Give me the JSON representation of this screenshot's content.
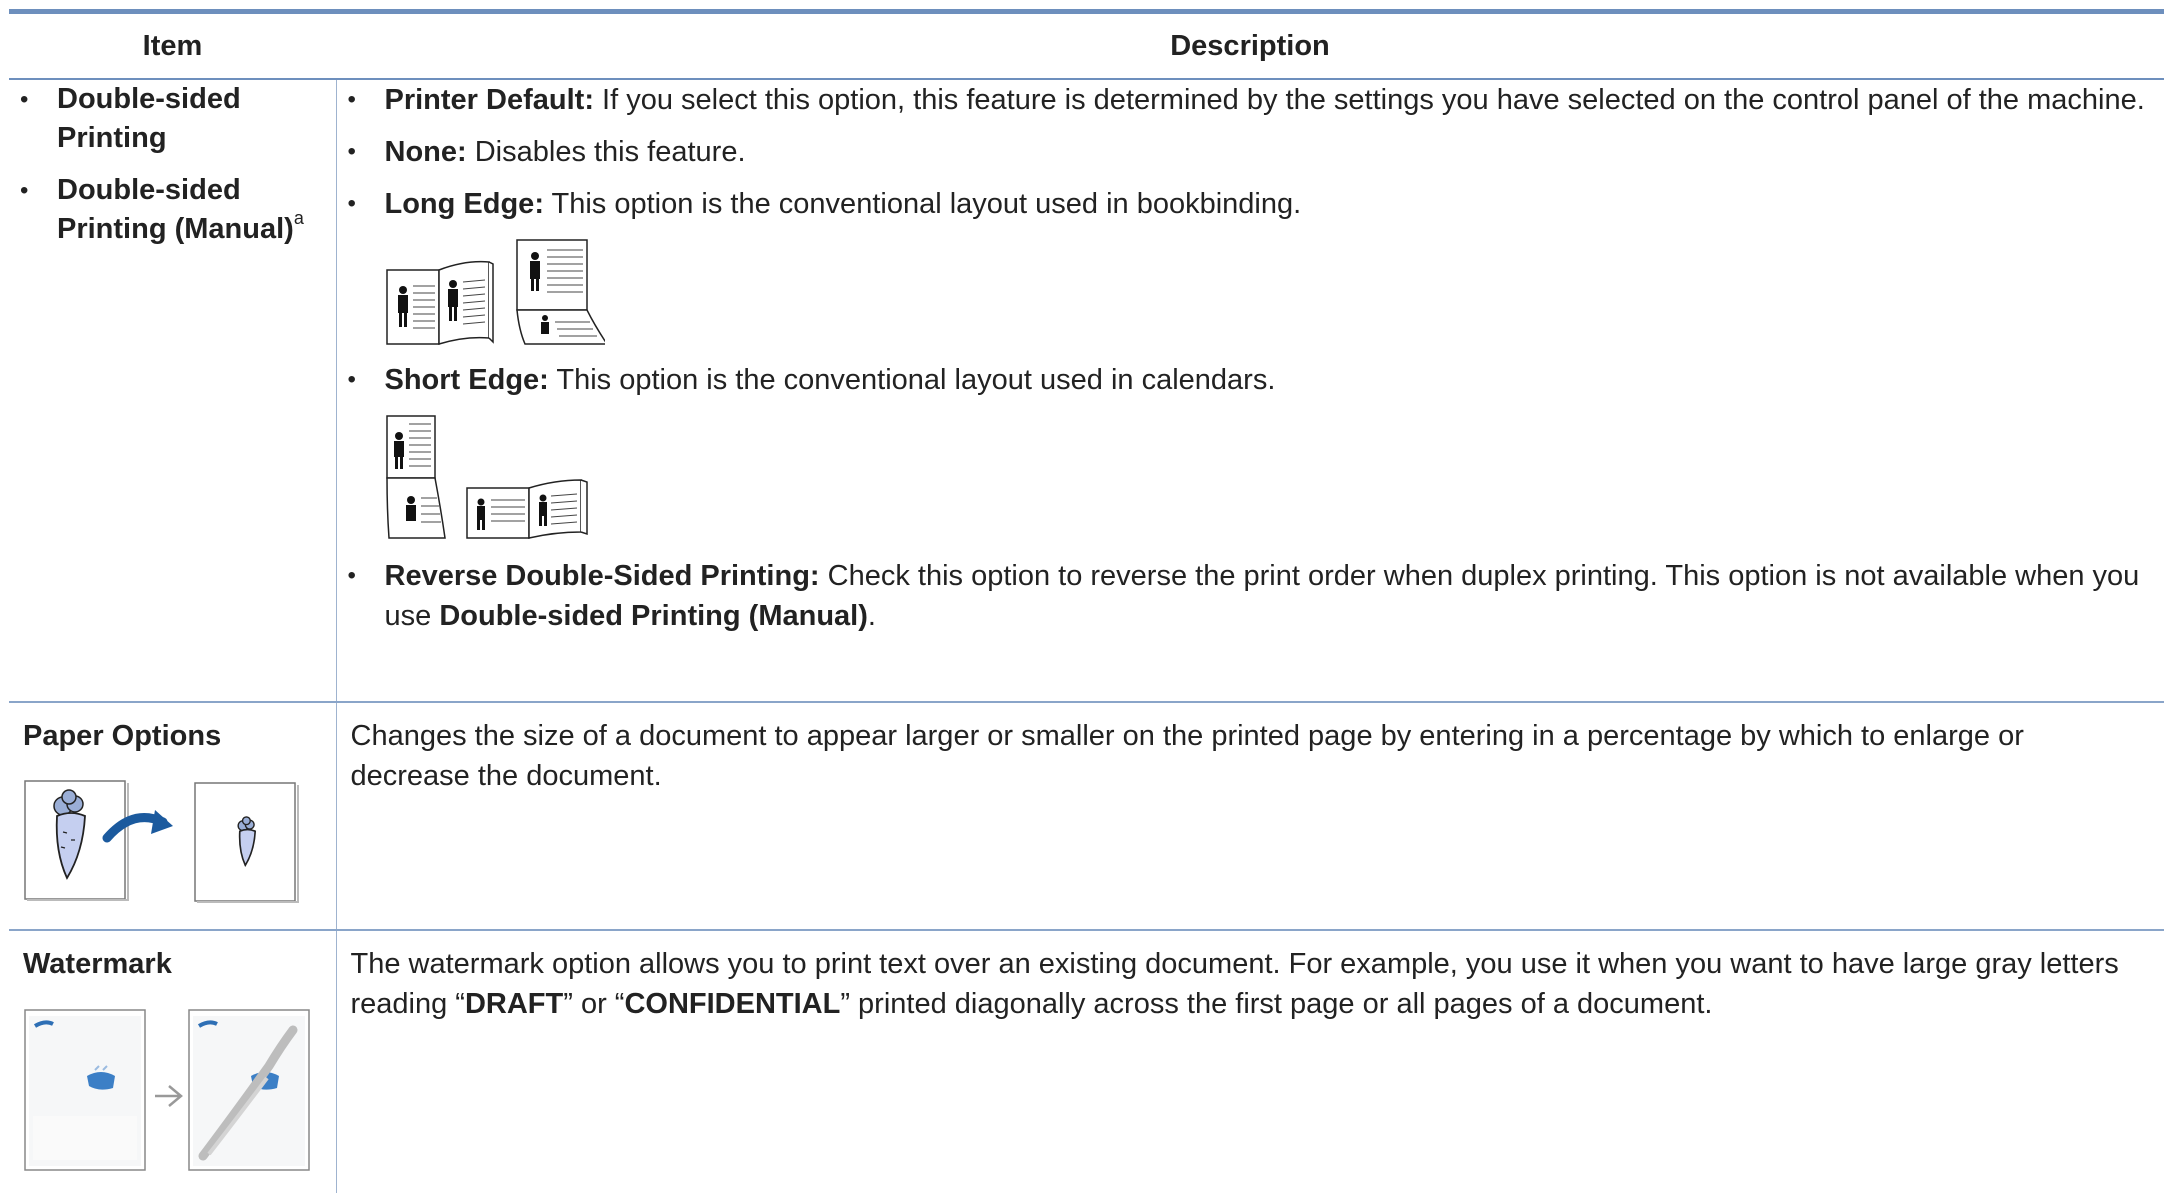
{
  "table": {
    "headers": {
      "item": "Item",
      "description": "Description"
    },
    "row1": {
      "items": [
        {
          "label": "Double-sided Printing"
        },
        {
          "label": "Double-sided Printing (Manual)",
          "footnote": "a"
        }
      ],
      "options": {
        "printer_default": {
          "term": "Printer Default:",
          "text": " If you select this option, this feature is determined by the settings you have selected on the control panel of the machine."
        },
        "none": {
          "term": "None:",
          "text": " Disables this feature."
        },
        "long_edge": {
          "term": "Long Edge:",
          "text": " This option is the conventional layout used in bookbinding."
        },
        "short_edge": {
          "term": "Short Edge:",
          "text": " This option is the conventional layout used in calendars."
        },
        "reverse": {
          "term": "Reverse Double-Sided Printing:",
          "text": " Check this option to reverse the print order when duplex printing. This option is not available when you use ",
          "ref": "Double-sided Printing (Manual)",
          "end": "."
        }
      }
    },
    "row2": {
      "item": "Paper Options",
      "description": "Changes the size of a document to appear larger or smaller on the printed page by entering in a percentage by which to enlarge or decrease the document."
    },
    "row3": {
      "item": "Watermark",
      "desc_part1": "The watermark option allows you to print text over an existing document. For example, you use it when you want to have large gray letters reading “",
      "draft": "DRAFT",
      "desc_part2": "” or “",
      "confidential": "CONFIDENTIAL",
      "desc_part3": "” printed diagonally across the first page or all pages of a document."
    }
  },
  "icons": {
    "long_edge": "long-edge-duplex-icon",
    "short_edge": "short-edge-duplex-icon",
    "paper_options": "carrot-scaling-icon",
    "watermark": "watermark-pages-icon"
  },
  "colors": {
    "rule": "#6d8fbd",
    "arrow": "#1b5a9e",
    "carrot": "#b9c6e8"
  }
}
